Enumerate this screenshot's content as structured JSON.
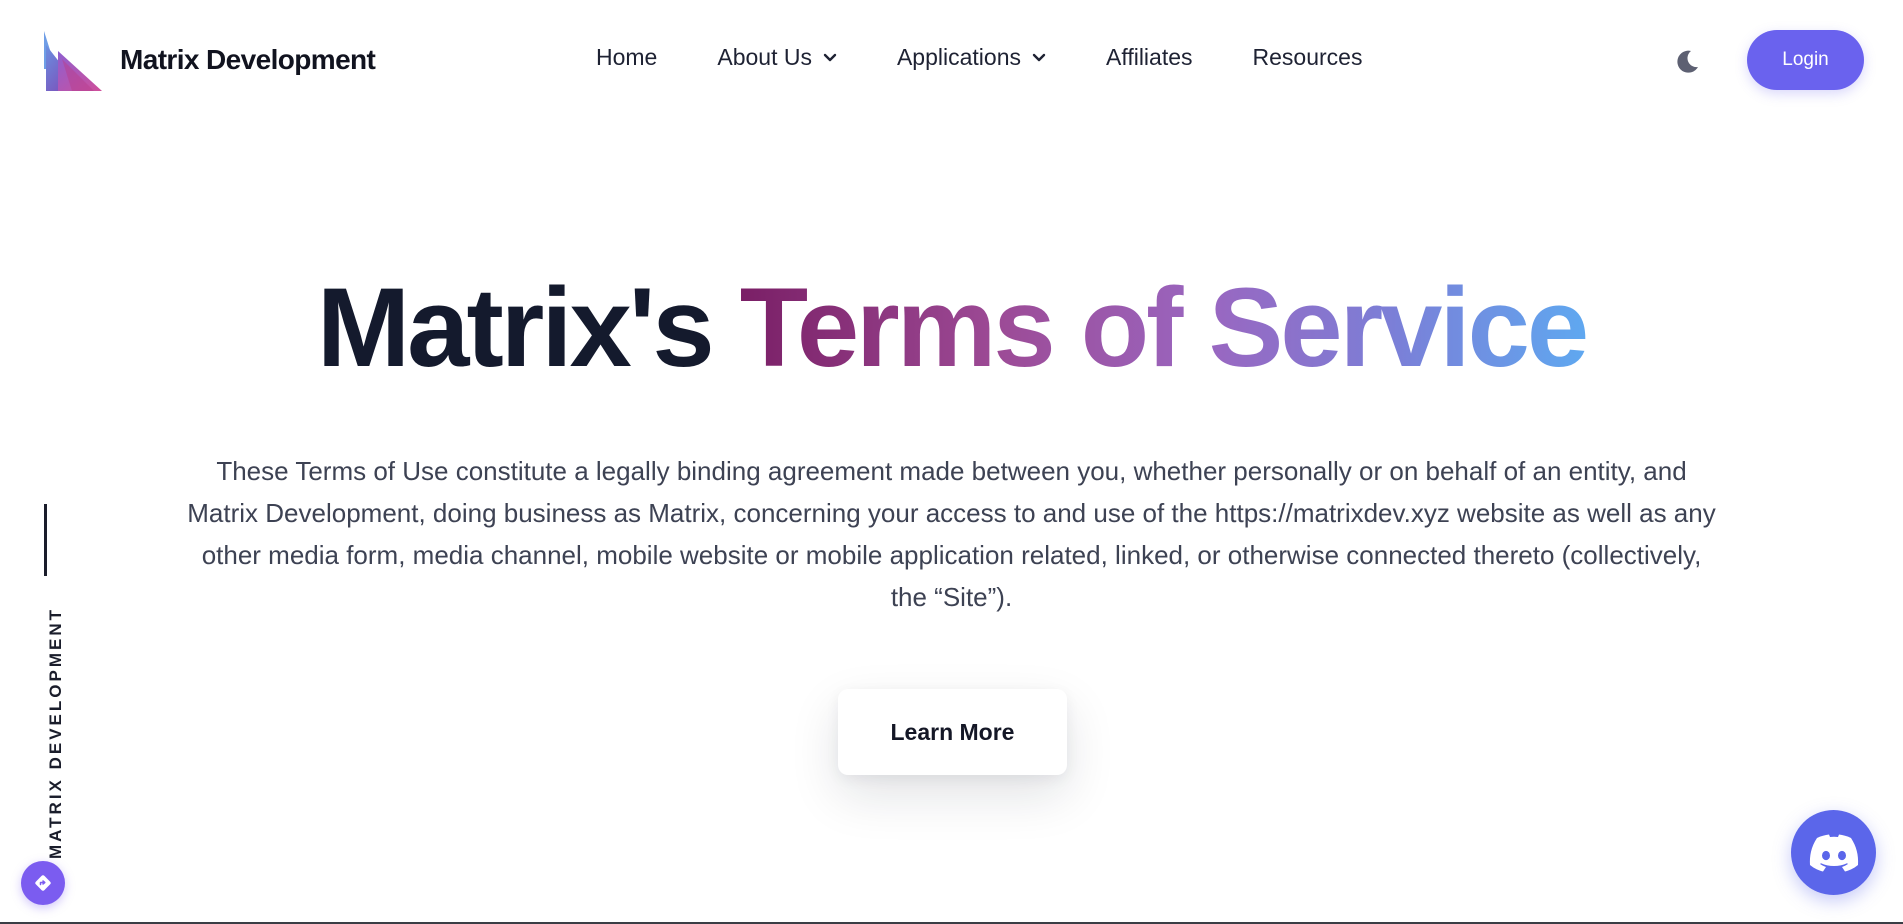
{
  "header": {
    "brand_name": "Matrix Development",
    "nav": [
      {
        "label": "Home",
        "has_dropdown": false
      },
      {
        "label": "About Us",
        "has_dropdown": true
      },
      {
        "label": "Applications",
        "has_dropdown": true
      },
      {
        "label": "Affiliates",
        "has_dropdown": false
      },
      {
        "label": "Resources",
        "has_dropdown": false
      }
    ],
    "theme_toggle_icon": "moon-icon",
    "login_label": "Login"
  },
  "hero": {
    "title_part1": "Matrix's ",
    "title_part2": "Terms of Service",
    "description": "These Terms of Use constitute a legally binding agreement made between you, whether personally or on behalf of an entity, and Matrix Development, doing business as Matrix, concerning your access to and use of the https://matrixdev.xyz website as well as any other media form, media channel, mobile website or mobile application related, linked, or otherwise connected thereto (collectively, the “Site”).",
    "cta_label": "Learn More"
  },
  "side_label": "MATRIX DEVELOPMENT",
  "floating": {
    "left_icon": "diamond-arrow-icon",
    "right_icon": "discord-icon"
  },
  "colors": {
    "accent": "#6a62ee",
    "discord": "#5b66ea",
    "title_dark": "#141a2d",
    "gradient_start": "#7a1f66",
    "gradient_end": "#5fa8f0"
  }
}
